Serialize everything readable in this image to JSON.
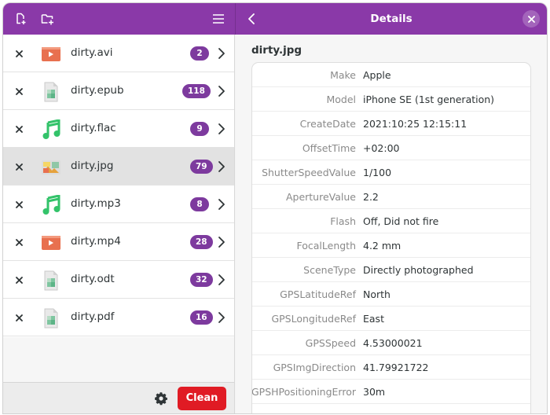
{
  "header": {
    "title": "Details",
    "accent": "#8a39a8"
  },
  "toolbar": {
    "add_files_icon": "add-files-icon",
    "add_folder_icon": "add-folder-icon",
    "menu_icon": "hamburger-menu-icon",
    "back_icon": "chevron-left-icon",
    "close_icon": "close-icon"
  },
  "files": [
    {
      "name": "dirty.avi",
      "count": "2",
      "type": "video"
    },
    {
      "name": "dirty.epub",
      "count": "118",
      "type": "document"
    },
    {
      "name": "dirty.flac",
      "count": "9",
      "type": "audio"
    },
    {
      "name": "dirty.jpg",
      "count": "79",
      "type": "image",
      "selected": true
    },
    {
      "name": "dirty.mp3",
      "count": "8",
      "type": "audio"
    },
    {
      "name": "dirty.mp4",
      "count": "28",
      "type": "video"
    },
    {
      "name": "dirty.odt",
      "count": "32",
      "type": "document"
    },
    {
      "name": "dirty.pdf",
      "count": "16",
      "type": "document"
    }
  ],
  "footer": {
    "clean_label": "Clean",
    "clean_color": "#e01b24"
  },
  "details": {
    "filename": "dirty.jpg",
    "metadata": [
      {
        "key": "Make",
        "value": "Apple"
      },
      {
        "key": "Model",
        "value": "iPhone SE (1st generation)"
      },
      {
        "key": "CreateDate",
        "value": "2021:10:25 12:15:11"
      },
      {
        "key": "OffsetTime",
        "value": "+02:00"
      },
      {
        "key": "ShutterSpeedValue",
        "value": "1/100"
      },
      {
        "key": "ApertureValue",
        "value": "2.2"
      },
      {
        "key": "Flash",
        "value": "Off, Did not fire"
      },
      {
        "key": "FocalLength",
        "value": "4.2 mm"
      },
      {
        "key": "SceneType",
        "value": "Directly photographed"
      },
      {
        "key": "GPSLatitudeRef",
        "value": "North"
      },
      {
        "key": "GPSLongitudeRef",
        "value": "East"
      },
      {
        "key": "GPSSpeed",
        "value": "4.53000021"
      },
      {
        "key": "GPSImgDirection",
        "value": "41.79921722"
      },
      {
        "key": "GPSHPositioningError",
        "value": "30m"
      }
    ]
  }
}
